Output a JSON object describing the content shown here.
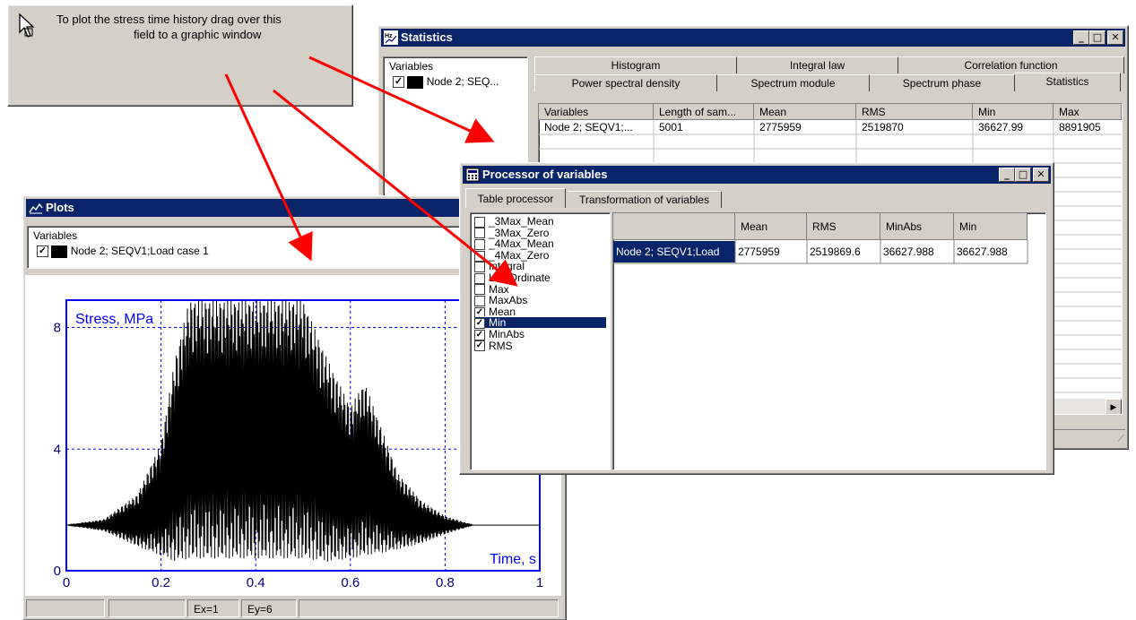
{
  "tooltip": {
    "line1": "To plot the stress time history drag over this",
    "line2": "field to a graphic window"
  },
  "statistics": {
    "title": "Statistics",
    "variables_label": "Variables",
    "variable_item": "Node 2; SEQ...",
    "tabs_row1": [
      "Histogram",
      "Integral law",
      "Correlation function"
    ],
    "tabs_row2": [
      "Power spectral density",
      "Spectrum module",
      "Spectrum phase",
      "Statistics"
    ],
    "table_headers": [
      "Variables",
      "Length of sam...",
      "Mean",
      "RMS",
      "Min",
      "Max"
    ],
    "table_row": [
      "Node 2; SEQV1;...",
      "5001",
      "2775959",
      "2519870",
      "36627.99",
      "8891905"
    ]
  },
  "processor": {
    "title": "Processor of variables",
    "tabs": [
      "Table processor",
      "Transformation of variables"
    ],
    "list": [
      {
        "label": "_3Max_Mean",
        "checked": false
      },
      {
        "label": "_3Max_Zero",
        "checked": false
      },
      {
        "label": "_4Max_Mean",
        "checked": false
      },
      {
        "label": "_4Max_Zero",
        "checked": false
      },
      {
        "label": "Integral",
        "checked": false
      },
      {
        "label": "LastOrdinate",
        "checked": false
      },
      {
        "label": "Max",
        "checked": false
      },
      {
        "label": "MaxAbs",
        "checked": false
      },
      {
        "label": "Mean",
        "checked": true
      },
      {
        "label": "Min",
        "checked": true,
        "selected": true
      },
      {
        "label": "MinAbs",
        "checked": true
      },
      {
        "label": "RMS",
        "checked": true
      }
    ],
    "grid_headers": [
      "",
      "Mean",
      "RMS",
      "MinAbs",
      "Min"
    ],
    "grid_row": [
      "Node 2; SEQV1;Load",
      "2775959",
      "2519869.6",
      "36627.988",
      "36627.988"
    ]
  },
  "plots": {
    "title": "Plots",
    "variables_label": "Variables",
    "variable_item": "Node 2; SEQV1;Load case 1",
    "status": [
      "",
      "",
      "Ex=1",
      "Ey=6",
      ""
    ]
  },
  "chart_data": {
    "type": "line",
    "ylabel": "Stress, MPa",
    "xlabel": "Time, s",
    "x_ticks": [
      "0",
      "0.2",
      "0.4",
      "0.6",
      "0.8",
      "1"
    ],
    "y_ticks": [
      "0",
      "4",
      "8"
    ],
    "xlim": [
      0,
      1
    ],
    "ylim": [
      0,
      8.9
    ],
    "grid": true,
    "series": [
      {
        "color": "#000000",
        "envelope_x": [
          0.0,
          0.08,
          0.15,
          0.2,
          0.23,
          0.26,
          0.5,
          0.55,
          0.6,
          0.63,
          0.67,
          0.7,
          0.75,
          0.8,
          0.86,
          1.0
        ],
        "envelope_upper": [
          1.5,
          1.7,
          2.5,
          4.2,
          7.0,
          8.9,
          8.9,
          7.0,
          5.4,
          6.2,
          4.5,
          3.2,
          2.3,
          1.8,
          1.5,
          1.5
        ],
        "envelope_lower": [
          1.5,
          1.3,
          0.8,
          0.5,
          0.3,
          0.4,
          0.4,
          0.3,
          0.4,
          0.5,
          0.6,
          0.7,
          0.9,
          1.2,
          1.5,
          1.5
        ]
      }
    ]
  },
  "arrows": {
    "color": "#ff0000"
  }
}
